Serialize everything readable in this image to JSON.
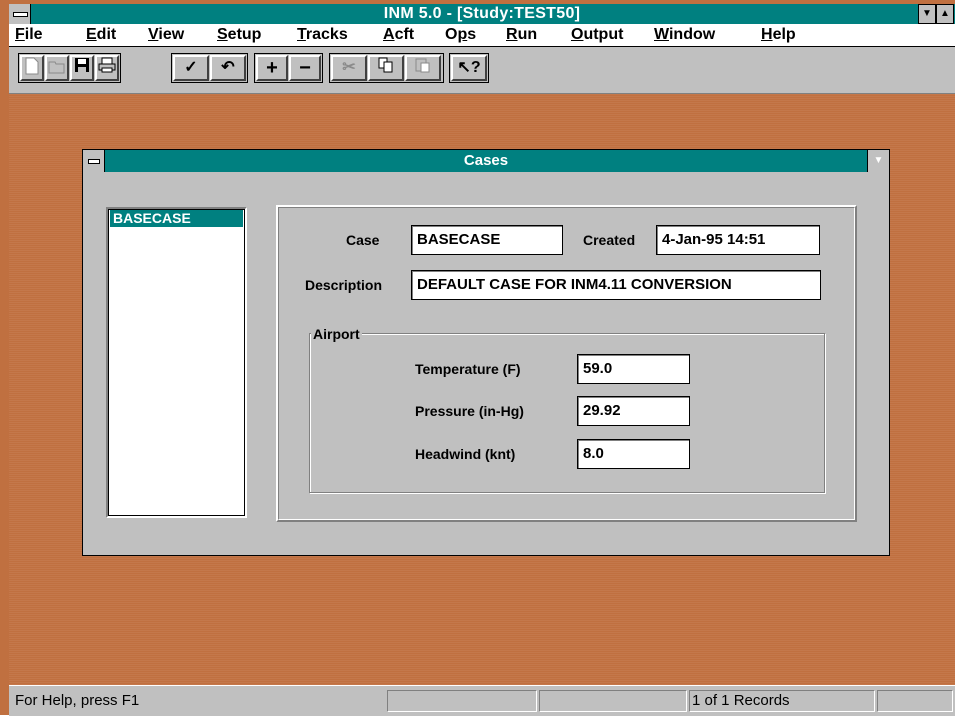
{
  "app": {
    "title": "INM 5.0 - [Study:TEST50]"
  },
  "menu": [
    "File",
    "Edit",
    "View",
    "Setup",
    "Tracks",
    "Acft",
    "Ops",
    "Run",
    "Output",
    "Window",
    "Help"
  ],
  "menu_mnemonic": [
    "F",
    "E",
    "V",
    "S",
    "T",
    "A",
    "p",
    "R",
    "O",
    "W",
    "H"
  ],
  "toolbar": {
    "icons": [
      "new-icon",
      "open-icon",
      "save-icon",
      "print-icon",
      "check-icon",
      "undo-icon",
      "add-icon",
      "remove-icon",
      "cut-icon",
      "copy-icon",
      "paste-icon",
      "help-pointer-icon"
    ]
  },
  "dialog": {
    "title": "Cases",
    "list": [
      "BASECASE"
    ],
    "case_label": "Case",
    "case_value": "BASECASE",
    "created_label": "Created",
    "created_value": "4-Jan-95 14:51",
    "description_label": "Description",
    "description_value": "DEFAULT CASE FOR INM4.11 CONVERSION",
    "airport_label": "Airport",
    "temperature_label": "Temperature (F)",
    "temperature_value": "59.0",
    "pressure_label": "Pressure (in-Hg)",
    "pressure_value": "29.92",
    "headwind_label": "Headwind (knt)",
    "headwind_value": "8.0"
  },
  "status": {
    "help": "For Help, press F1",
    "records": "1 of 1  Records"
  },
  "colors": {
    "titlebar": "#008080",
    "workspace": "#c07040",
    "face": "#c0c0c0"
  }
}
